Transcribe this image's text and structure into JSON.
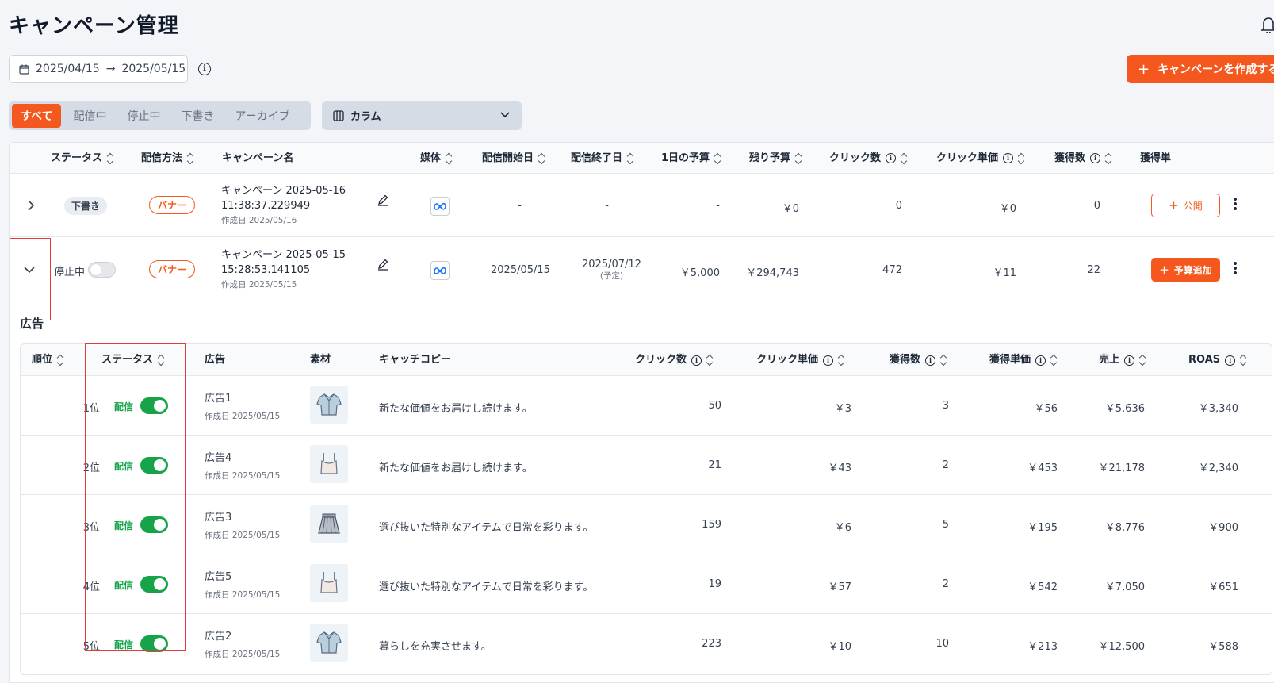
{
  "header": {
    "title": "キャンペーン管理"
  },
  "date_range": {
    "start": "2025/04/15",
    "arrow": "→",
    "end": "2025/05/15"
  },
  "create_button": {
    "label": "キャンペーンを作成する"
  },
  "tabs": [
    {
      "label": "すべて",
      "active": true
    },
    {
      "label": "配信中",
      "active": false
    },
    {
      "label": "停止中",
      "active": false
    },
    {
      "label": "下書き",
      "active": false
    },
    {
      "label": "アーカイブ",
      "active": false
    }
  ],
  "column_select": {
    "label": "カラム"
  },
  "campaign_table": {
    "headers": {
      "status": "ステータス",
      "method": "配信方法",
      "name": "キャンペーン名",
      "media": "媒体",
      "start": "配信開始日",
      "end": "配信終了日",
      "daily_budget": "1日の予算",
      "remaining": "残り予算",
      "clicks": "クリック数",
      "cpc": "クリック単価",
      "conversions": "獲得数",
      "cpa": "獲得単"
    },
    "rows": [
      {
        "status": "下書き",
        "method": "バナー",
        "name_line1": "キャンペーン 2025-05-16",
        "name_line2": "11:38:37.229949",
        "created": "作成日 2025/05/16",
        "start": "-",
        "end": "-",
        "end_note": "",
        "daily_budget": "-",
        "remaining": "￥0",
        "clicks": "0",
        "cpc": "￥0",
        "conversions": "0",
        "action": "公開"
      },
      {
        "status": "停止中",
        "method": "バナー",
        "name_line1": "キャンペーン 2025-05-15",
        "name_line2": "15:28:53.141105",
        "created": "作成日 2025/05/15",
        "start": "2025/05/15",
        "end": "2025/07/12",
        "end_note": "(予定)",
        "daily_budget": "￥5,000",
        "remaining": "￥294,743",
        "clicks": "472",
        "cpc": "￥11",
        "conversions": "22",
        "action": "予算追加"
      }
    ]
  },
  "ads_section": {
    "title": "広告",
    "headers": {
      "rank": "順位",
      "status": "ステータス",
      "ad": "広告",
      "material": "素材",
      "copy": "キャッチコピー",
      "clicks": "クリック数",
      "cpc": "クリック単価",
      "conversions": "獲得数",
      "cpa": "獲得単価",
      "sales": "売上",
      "roas": "ROAS"
    },
    "rows": [
      {
        "rank": "1位",
        "status": "配信",
        "name": "広告1",
        "created": "作成日 2025/05/15",
        "material": "shirt-icon",
        "copy": "新たな価値をお届けし続けます。",
        "clicks": "50",
        "cpc": "￥3",
        "conversions": "3",
        "cpa": "￥56",
        "sales": "￥5,636",
        "roas": "￥3,340"
      },
      {
        "rank": "2位",
        "status": "配信",
        "name": "広告4",
        "created": "作成日 2025/05/15",
        "material": "camisole-icon",
        "copy": "新たな価値をお届けし続けます。",
        "clicks": "21",
        "cpc": "￥43",
        "conversions": "2",
        "cpa": "￥453",
        "sales": "￥21,178",
        "roas": "￥2,340"
      },
      {
        "rank": "3位",
        "status": "配信",
        "name": "広告3",
        "created": "作成日 2025/05/15",
        "material": "skirt-icon",
        "copy": "選び抜いた特別なアイテムで日常を彩ります。",
        "clicks": "159",
        "cpc": "￥6",
        "conversions": "5",
        "cpa": "￥195",
        "sales": "￥8,776",
        "roas": "￥900"
      },
      {
        "rank": "4位",
        "status": "配信",
        "name": "広告5",
        "created": "作成日 2025/05/15",
        "material": "camisole-icon",
        "copy": "選び抜いた特別なアイテムで日常を彩ります。",
        "clicks": "19",
        "cpc": "￥57",
        "conversions": "2",
        "cpa": "￥542",
        "sales": "￥7,050",
        "roas": "￥651"
      },
      {
        "rank": "5位",
        "status": "配信",
        "name": "広告2",
        "created": "作成日 2025/05/15",
        "material": "shirt-icon",
        "copy": "暮らしを充実させます。",
        "clicks": "223",
        "cpc": "￥10",
        "conversions": "10",
        "cpa": "￥213",
        "sales": "￥12,500",
        "roas": "￥588"
      }
    ]
  },
  "colors": {
    "accent": "#f5581e",
    "live": "#16a34a",
    "highlight": "#e23b3b"
  }
}
